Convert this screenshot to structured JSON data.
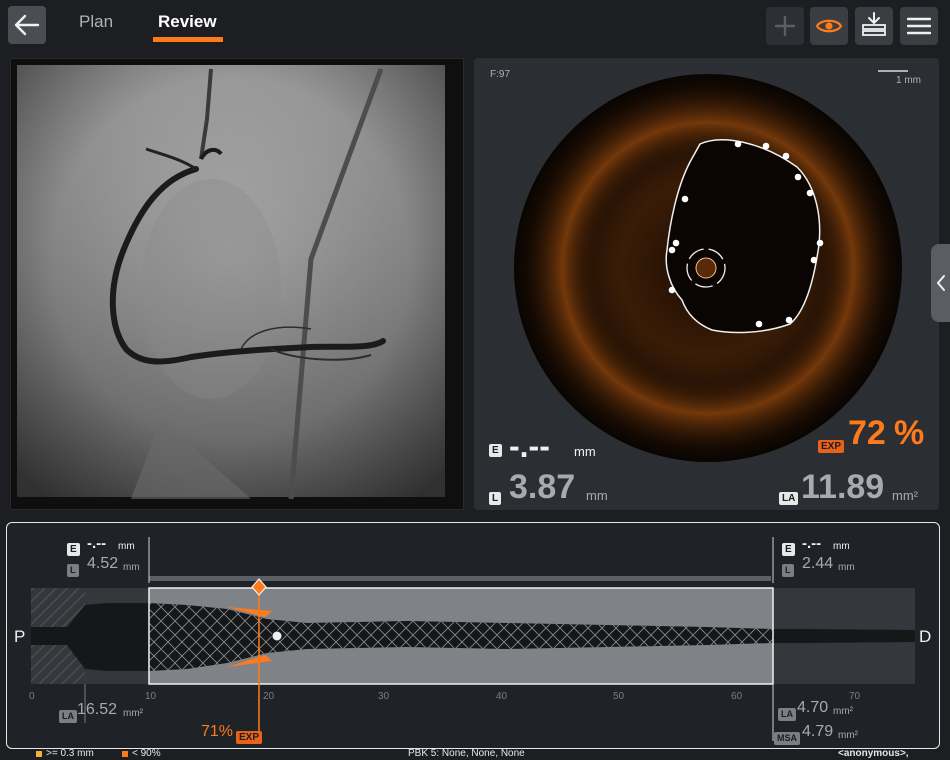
{
  "tabs": {
    "plan": "Plan",
    "review": "Review"
  },
  "colors": {
    "accent": "#ff7a1a",
    "background": "#1c1e21",
    "panel": "#2b2f33"
  },
  "icons": {
    "back": "arrow-left-icon",
    "add": "plus-icon",
    "view": "eye-icon",
    "export": "download-tray-icon",
    "menu": "hamburger-menu-icon",
    "side": "chevron-left-icon"
  },
  "oct": {
    "frame": "F:97",
    "scale_label": "1 mm",
    "e_badge": "E",
    "e_value": "-.--",
    "e_unit": "mm",
    "exp_badge": "EXP",
    "exp_value": "72",
    "exp_unit": "%",
    "l_badge": "L",
    "l_value": "3.87",
    "l_unit": "mm",
    "la_badge": "LA",
    "la_value": "11.89",
    "la_unit": "mm²"
  },
  "long": {
    "left": {
      "e_value": "-.--",
      "e_unit": "mm",
      "l_value": "4.52",
      "l_unit": "mm",
      "la_value": "16.52",
      "la_unit": "mm²"
    },
    "right": {
      "e_value": "-.--",
      "e_unit": "mm",
      "l_value": "2.44",
      "l_unit": "mm",
      "la_value": "4.70",
      "la_unit": "mm²",
      "msa_badge": "MSA",
      "msa_value": "4.79",
      "msa_unit": "mm²"
    },
    "proximal": "P",
    "distal": "D",
    "exp_marker": "71%",
    "exp_badge": "EXP",
    "axis_ticks": [
      "0",
      "10",
      "20",
      "30",
      "40",
      "50",
      "60",
      "70"
    ],
    "badge_e": "E",
    "badge_l": "L",
    "badge_la": "LA"
  },
  "footer": {
    "legend1": ">= 0.3 mm",
    "legend2": "< 90%",
    "legend1_color": "#f2b233",
    "legend2_color": "#ff7a1a",
    "pbk": "PBK 5:  None,  None,  None",
    "patient": "<anonymous>,"
  }
}
